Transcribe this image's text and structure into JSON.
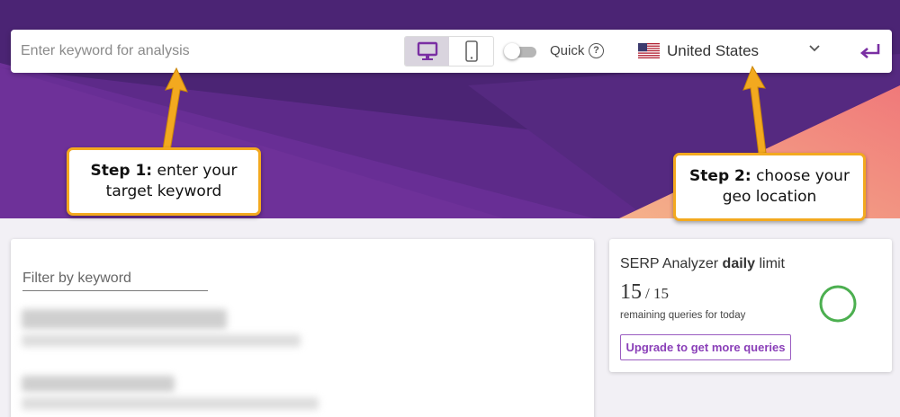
{
  "search": {
    "placeholder": "Enter keyword for analysis",
    "quick_label": "Quick",
    "help_glyph": "?",
    "country": "United States",
    "device_options": [
      "desktop-icon",
      "mobile-icon"
    ],
    "active_device": "desktop"
  },
  "callouts": {
    "step1": {
      "bold": "Step 1:",
      "text_line1": " enter your",
      "text_line2": "target keyword"
    },
    "step2": {
      "bold": "Step 2:",
      "text_line1": " choose your",
      "text_line2": "geo location"
    }
  },
  "filter": {
    "placeholder": "Filter by keyword"
  },
  "limit": {
    "title_prefix": "SERP Analyzer ",
    "title_bold": "daily",
    "title_suffix": " limit",
    "remaining": "15",
    "total": "/ 15",
    "remaining_fraction": 1.0,
    "remaining_text": "remaining queries for today",
    "upgrade_label": "Upgrade to get more queries"
  },
  "colors": {
    "hero_purple": "#4b2474",
    "accent_purple": "#7a2fa3",
    "callout_border": "#f3a91f",
    "ring_green": "#4caf50",
    "upgrade_purple": "#8a3fb8"
  }
}
